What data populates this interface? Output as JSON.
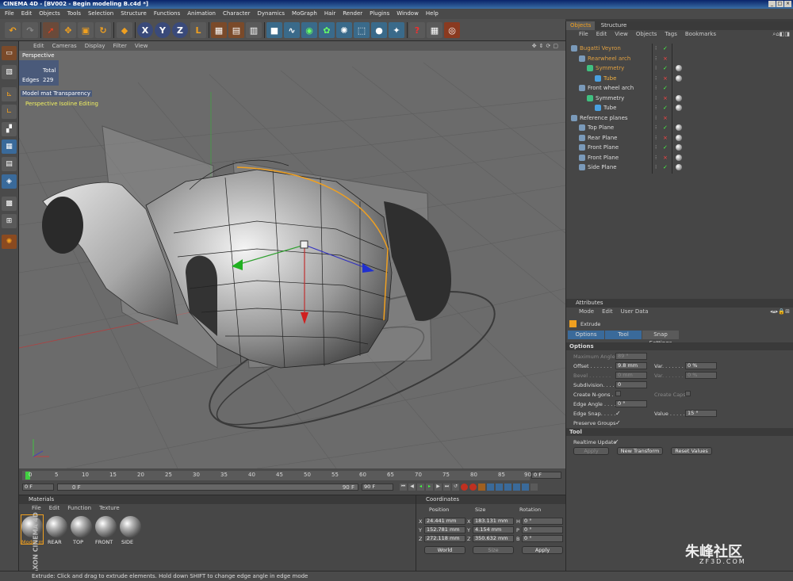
{
  "window": {
    "title": "CINEMA 4D - [BV002 - Begin modeling B.c4d *]"
  },
  "menubar": [
    "File",
    "Edit",
    "Objects",
    "Tools",
    "Selection",
    "Structure",
    "Functions",
    "Animation",
    "Character",
    "Dynamics",
    "MoGraph",
    "Hair",
    "Render",
    "Plugins",
    "Window",
    "Help"
  ],
  "viewport": {
    "menu": [
      "Edit",
      "Cameras",
      "Display",
      "Filter",
      "View"
    ],
    "camera_label": "Perspective",
    "stats": {
      "total_label": "Total",
      "edges_label": "Edges",
      "edges_value": "229"
    },
    "overlay_model": "Model mat Transparency",
    "overlay_mode": "Perspective Isoline Editing"
  },
  "timeline": {
    "ticks": [
      "0",
      "5",
      "10",
      "15",
      "20",
      "25",
      "30",
      "35",
      "40",
      "45",
      "50",
      "55",
      "60",
      "65",
      "70",
      "75",
      "80",
      "85",
      "90"
    ],
    "current_frame": "0 F",
    "start": "0 F",
    "start2": "0 F",
    "end": "90 F",
    "end2": "90 F"
  },
  "materials": {
    "title": "Materials",
    "menu": [
      "File",
      "Edit",
      "Function",
      "Texture"
    ],
    "items": [
      "Model m",
      "REAR",
      "TOP",
      "FRONT",
      "SIDE"
    ]
  },
  "coordinates": {
    "title": "Coordinates",
    "headers": [
      "Position",
      "Size",
      "Rotation"
    ],
    "rows": [
      {
        "axis": "X",
        "pos": "24.441 mm",
        "saxis": "X",
        "size": "183.131 mm",
        "raxis": "H",
        "rot": "0 °"
      },
      {
        "axis": "Y",
        "pos": "152.781 mm",
        "saxis": "Y",
        "size": "4.154 mm",
        "raxis": "P",
        "rot": "0 °"
      },
      {
        "axis": "Z",
        "pos": "272.118 mm",
        "saxis": "Z",
        "size": "350.632 mm",
        "raxis": "B",
        "rot": "0 °"
      }
    ],
    "space": "World",
    "size_mode": "Size",
    "apply": "Apply"
  },
  "objects": {
    "tabs": [
      "Objects",
      "Structure"
    ],
    "menu": [
      "File",
      "Edit",
      "View",
      "Objects",
      "Tags",
      "Bookmarks"
    ],
    "tree": [
      {
        "name": "Bugatti Veyron",
        "level": 0,
        "color": "#e0a040"
      },
      {
        "name": "Rearwheel arch",
        "level": 1,
        "color": "#e0a040"
      },
      {
        "name": "Symmetry",
        "level": 2,
        "color": "#e0a040"
      },
      {
        "name": "Tube",
        "level": 3,
        "color": "#f0b040"
      },
      {
        "name": "Front wheel arch",
        "level": 1,
        "color": "#dddddd"
      },
      {
        "name": "Symmetry",
        "level": 2,
        "color": "#dddddd"
      },
      {
        "name": "Tube",
        "level": 3,
        "color": "#dddddd"
      },
      {
        "name": "Reference planes",
        "level": 0,
        "color": "#dddddd"
      },
      {
        "name": "Top Plane",
        "level": 1,
        "color": "#dddddd"
      },
      {
        "name": "Rear Plane",
        "level": 1,
        "color": "#dddddd"
      },
      {
        "name": "Front Plane",
        "level": 1,
        "color": "#dddddd"
      },
      {
        "name": "Front Plane",
        "level": 1,
        "color": "#dddddd"
      },
      {
        "name": "Side Plane",
        "level": 1,
        "color": "#dddddd"
      }
    ]
  },
  "attributes": {
    "title": "Attributes",
    "menu": [
      "Mode",
      "Edit",
      "User Data"
    ],
    "tool_name": "Extrude",
    "tabs": [
      "Options",
      "Tool",
      "Snap Settings"
    ],
    "options_header": "Options",
    "fields": {
      "max_angle_label": "Maximum Angle",
      "max_angle": "89 °",
      "offset_label": "Offset . . . . . . .",
      "offset": "9.8 mm",
      "var_label": "Var. . . . . . .",
      "offset_var": "0 %",
      "bevel_label": "Bevel . . . . . . .",
      "bevel": "0 mm",
      "bevel_var": "0 %",
      "subdivision_label": "Subdivision. . . .",
      "subdivision": "0",
      "create_ngons_label": "Create N-gons . .",
      "create_caps_label": "Create Caps",
      "edge_angle_label": "Edge Angle . . . .",
      "edge_angle": "0 °",
      "edge_snap_label": "Edge Snap. . . . .",
      "value_label": "Value . . . . . .",
      "edge_snap_value": "15 °",
      "preserve_groups_label": "Preserve Groups"
    },
    "tool_header": "Tool",
    "realtime_label": "Realtime Update",
    "buttons": [
      "Apply",
      "New Transform",
      "Reset Values"
    ]
  },
  "statusbar": "Extrude: Click and drag to extrude elements. Hold down SHIFT to change edge angle in edge mode",
  "watermark": {
    "site": "朱峰社区",
    "url": "ZF3D.COM",
    "maxon": "MAXON CINEMA 4D"
  }
}
